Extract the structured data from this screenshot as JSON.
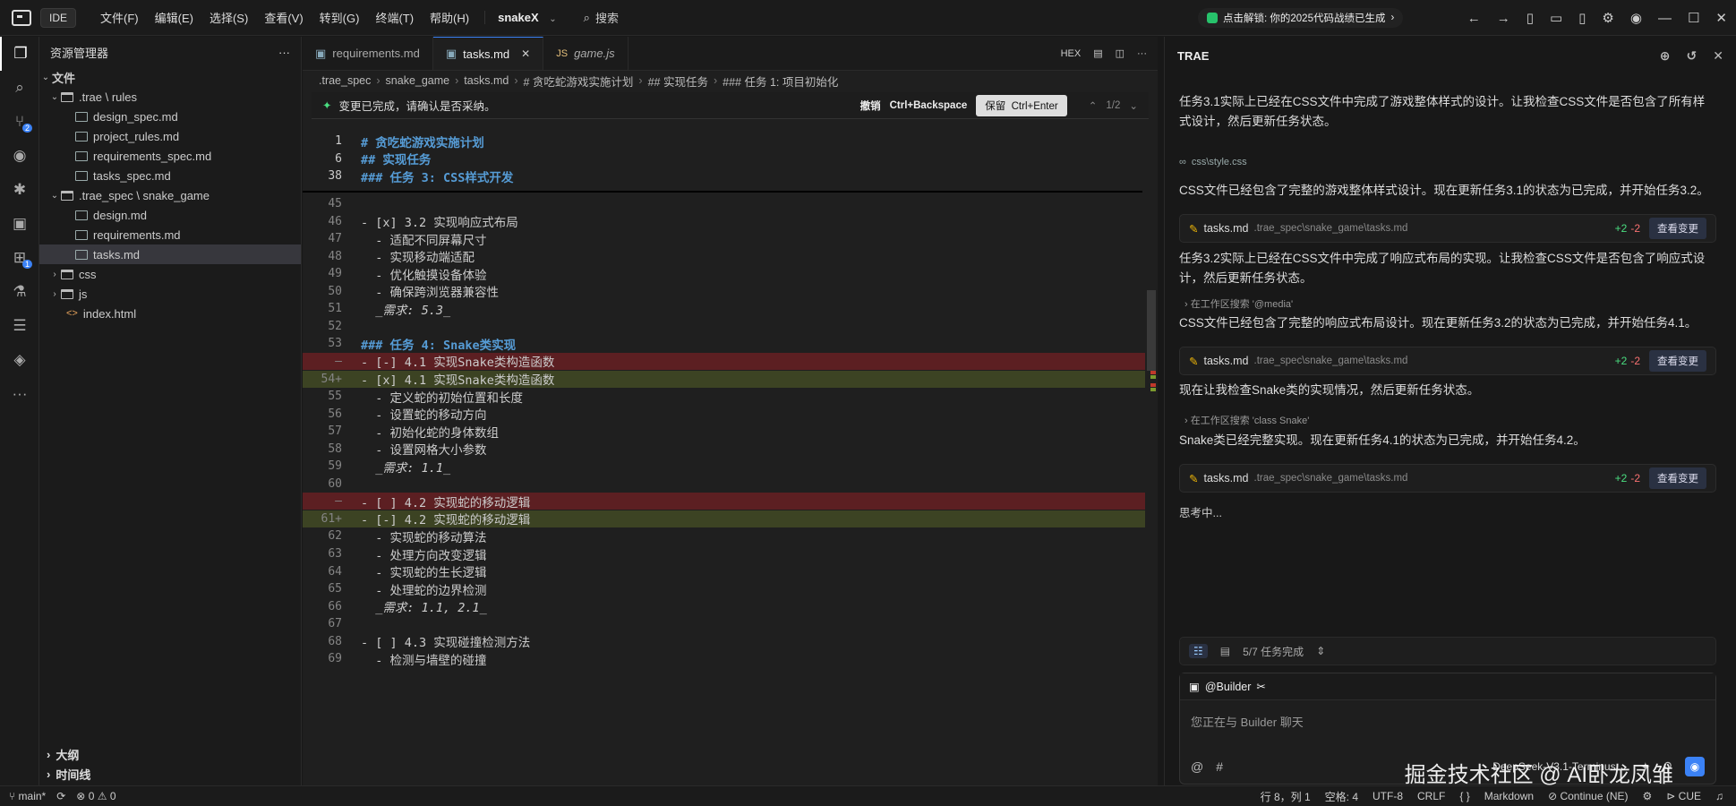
{
  "titlebar": {
    "ide_label": "IDE",
    "menu": [
      "文件(F)",
      "编辑(E)",
      "选择(S)",
      "查看(V)",
      "转到(G)",
      "终端(T)",
      "帮助(H)"
    ],
    "project": "snakeX",
    "search": "搜索",
    "promo": "点击解锁: 你的2025代码战绩已生成"
  },
  "explorer": {
    "title": "资源管理器",
    "section": "文件",
    "items": [
      {
        "label": ".trae \\ rules",
        "kind": "folder",
        "indent": 1
      },
      {
        "label": "design_spec.md",
        "kind": "file",
        "indent": 2
      },
      {
        "label": "project_rules.md",
        "kind": "file",
        "indent": 2
      },
      {
        "label": "requirements_spec.md",
        "kind": "file",
        "indent": 2
      },
      {
        "label": "tasks_spec.md",
        "kind": "file",
        "indent": 2
      },
      {
        "label": ".trae_spec \\ snake_game",
        "kind": "folder",
        "indent": 1
      },
      {
        "label": "design.md",
        "kind": "file",
        "indent": 2
      },
      {
        "label": "requirements.md",
        "kind": "file",
        "indent": 2
      },
      {
        "label": "tasks.md",
        "kind": "file",
        "indent": 2,
        "selected": true
      },
      {
        "label": "css",
        "kind": "folder-closed",
        "indent": 1
      },
      {
        "label": "js",
        "kind": "folder-closed",
        "indent": 1
      },
      {
        "label": "index.html",
        "kind": "html",
        "indent": 1
      }
    ],
    "outline": "大纲",
    "timeline": "时间线"
  },
  "activity": {
    "badge_scm": "2",
    "badge_ext": "1"
  },
  "editor": {
    "tabs": [
      {
        "label": "requirements.md",
        "active": false
      },
      {
        "label": "tasks.md",
        "active": true
      },
      {
        "label": "game.js",
        "active": false
      }
    ],
    "tab_hex": "HEX",
    "breadcrumb": [
      ".trae_spec",
      "snake_game",
      "tasks.md",
      "# 贪吃蛇游戏实施计划",
      "## 实现任务",
      "### 任务 1: 项目初始化"
    ],
    "change_notice": "变更已完成，请确认是否采纳。",
    "undo_label": "撤销",
    "undo_key": "Ctrl+Backspace",
    "keep_label": "保留",
    "keep_key": "Ctrl+Enter",
    "change_counter": "1/2",
    "lines": [
      {
        "n": "1",
        "t": "# 贪吃蛇游戏实施计划",
        "cls": "h"
      },
      {
        "n": "6",
        "t": "## 实现任务",
        "cls": "h"
      },
      {
        "n": "38",
        "t": "### 任务 3: CSS样式开发",
        "cls": "h"
      },
      {
        "n": "45",
        "t": "",
        "cls": ""
      },
      {
        "n": "46",
        "t": "- [x] 3.2 实现响应式布局",
        "cls": ""
      },
      {
        "n": "47",
        "t": "  - 适配不同屏幕尺寸",
        "cls": ""
      },
      {
        "n": "48",
        "t": "  - 实现移动端适配",
        "cls": ""
      },
      {
        "n": "49",
        "t": "  - 优化触摸设备体验",
        "cls": ""
      },
      {
        "n": "50",
        "t": "  - 确保跨浏览器兼容性",
        "cls": ""
      },
      {
        "n": "51",
        "t": "  _需求: 5.3_",
        "cls": "it"
      },
      {
        "n": "52",
        "t": "",
        "cls": ""
      },
      {
        "n": "53",
        "t": "### 任务 4: Snake类实现",
        "cls": "h"
      },
      {
        "n": "—",
        "t": "- [-] 4.1 实现Snake类构造函数",
        "cls": "del"
      },
      {
        "n": "54+",
        "t": "- [x] 4.1 实现Snake类构造函数",
        "cls": "add"
      },
      {
        "n": "55",
        "t": "  - 定义蛇的初始位置和长度",
        "cls": ""
      },
      {
        "n": "56",
        "t": "  - 设置蛇的移动方向",
        "cls": ""
      },
      {
        "n": "57",
        "t": "  - 初始化蛇的身体数组",
        "cls": ""
      },
      {
        "n": "58",
        "t": "  - 设置网格大小参数",
        "cls": ""
      },
      {
        "n": "59",
        "t": "  _需求: 1.1_",
        "cls": "it"
      },
      {
        "n": "60",
        "t": "",
        "cls": ""
      },
      {
        "n": "—",
        "t": "- [ ] 4.2 实现蛇的移动逻辑",
        "cls": "del"
      },
      {
        "n": "61+",
        "t": "- [-] 4.2 实现蛇的移动逻辑",
        "cls": "add"
      },
      {
        "n": "62",
        "t": "  - 实现蛇的移动算法",
        "cls": ""
      },
      {
        "n": "63",
        "t": "  - 处理方向改变逻辑",
        "cls": ""
      },
      {
        "n": "64",
        "t": "  - 实现蛇的生长逻辑",
        "cls": ""
      },
      {
        "n": "65",
        "t": "  - 处理蛇的边界检测",
        "cls": ""
      },
      {
        "n": "66",
        "t": "  _需求: 1.1, 2.1_",
        "cls": "it"
      },
      {
        "n": "67",
        "t": "",
        "cls": ""
      },
      {
        "n": "68",
        "t": "- [ ] 4.3 实现碰撞检测方法",
        "cls": ""
      },
      {
        "n": "69",
        "t": "  - 检测与墙壁的碰撞",
        "cls": ""
      }
    ]
  },
  "panel": {
    "title": "TRAE",
    "messages": [
      "任务3.1实际上已经在CSS文件中完成了游戏整体样式的设计。让我检查CSS文件是否包含了所有样式设计，然后更新任务状态。",
      "CSS文件已经包含了完整的游戏整体样式设计。现在更新任务3.1的状态为已完成，并开始任务3.2。",
      "任务3.2实际上已经在CSS文件中完成了响应式布局的实现。让我检查CSS文件是否包含了响应式设计，然后更新任务状态。",
      "CSS文件已经包含了完整的响应式布局设计。现在更新任务3.2的状态为已完成，并开始任务4.1。",
      "现在让我检查Snake类的实现情况，然后更新任务状态。",
      "Snake类已经完整实现。现在更新任务4.1的状态为已完成，并开始任务4.2。"
    ],
    "css_ref": "css\\style.css",
    "search_refs": [
      "在工作区搜索 '@media'",
      "在工作区搜索 'class Snake'"
    ],
    "card": {
      "file": "tasks.md",
      "path": ".trae_spec\\snake_game\\tasks.md",
      "plus": "+2",
      "minus": "-2",
      "view": "查看变更"
    },
    "thinking": "思考中...",
    "task_progress": "5/7 任务完成",
    "builder": "@Builder",
    "placeholder": "您正在与 Builder 聊天",
    "model": "DeepSeek-V3.1-Terminus"
  },
  "watermark": "掘金技术社区 @ AI卧龙凤雏",
  "status": {
    "branch": "main*",
    "errors": "0",
    "warnings": "0",
    "position": "行 8，列 1",
    "spaces": "空格: 4",
    "encoding": "UTF-8",
    "eol": "CRLF",
    "brackets": "{ }",
    "lang": "Markdown",
    "continue": "Continue (NE)",
    "cue": "CUE"
  }
}
